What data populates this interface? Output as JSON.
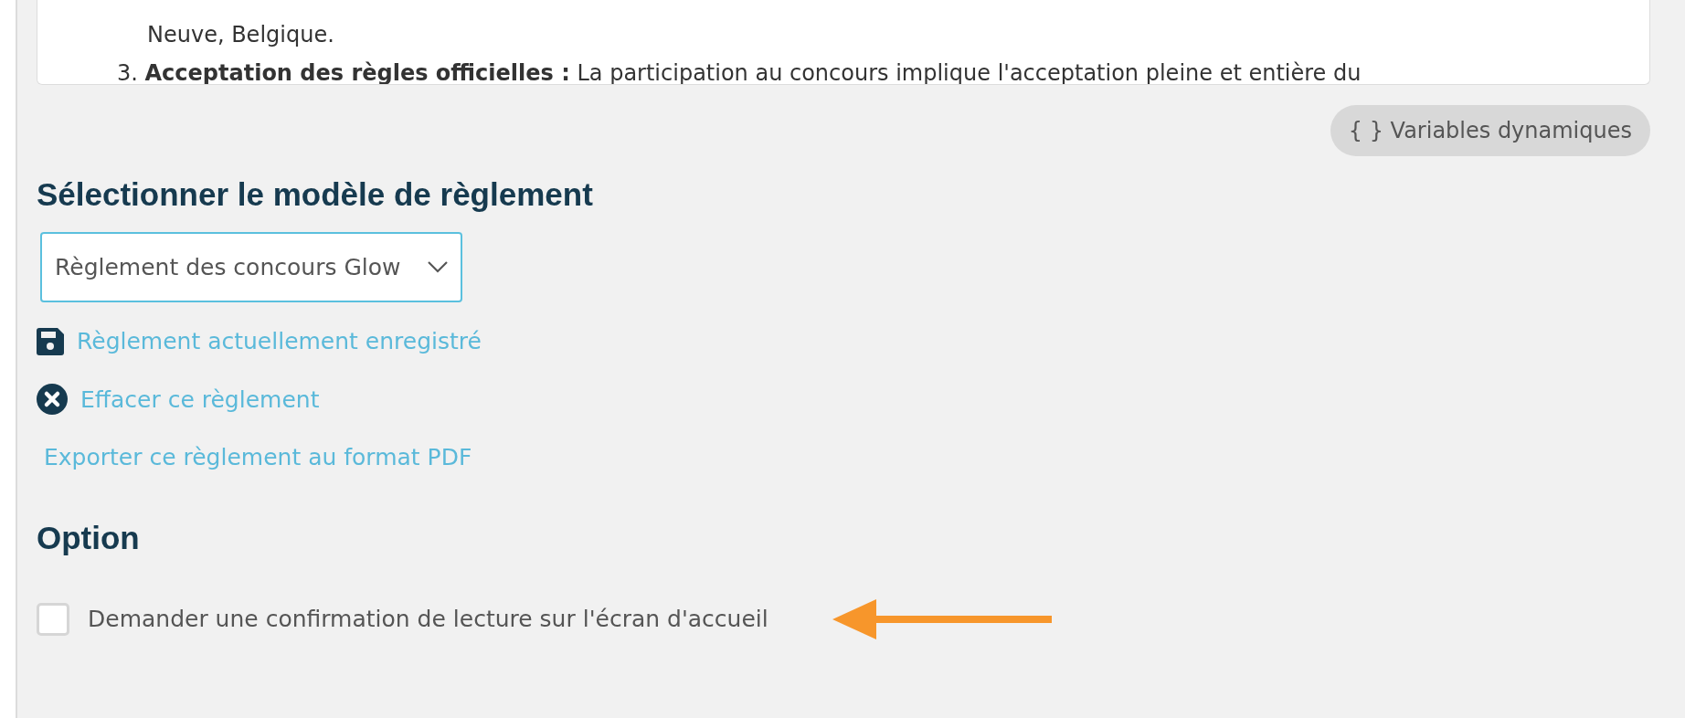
{
  "rules_preview": {
    "lines": [
      {
        "kind": "continuation",
        "text": "Neuve, Belgique."
      },
      {
        "kind": "item",
        "number": "3.",
        "text": "**Acceptation des règles officielles :** La participation au concours implique l'acceptation pleine et entière du"
      }
    ]
  },
  "variables_button": {
    "icon": "{ }",
    "label": "Variables dynamiques"
  },
  "template_section": {
    "title": "Sélectionner le modèle de règlement",
    "select": {
      "value": "Règlement des concours Glow"
    },
    "links": [
      {
        "kind": "save",
        "label": "Règlement actuellement enregistré"
      },
      {
        "kind": "clear",
        "label": "Effacer ce règlement"
      },
      {
        "kind": "plain",
        "label": "Exporter ce règlement au format PDF"
      }
    ]
  },
  "option_section": {
    "title": "Option",
    "checkbox": {
      "label": "Demander une confirmation de lecture sur l'écran d'accueil",
      "checked": false
    }
  }
}
